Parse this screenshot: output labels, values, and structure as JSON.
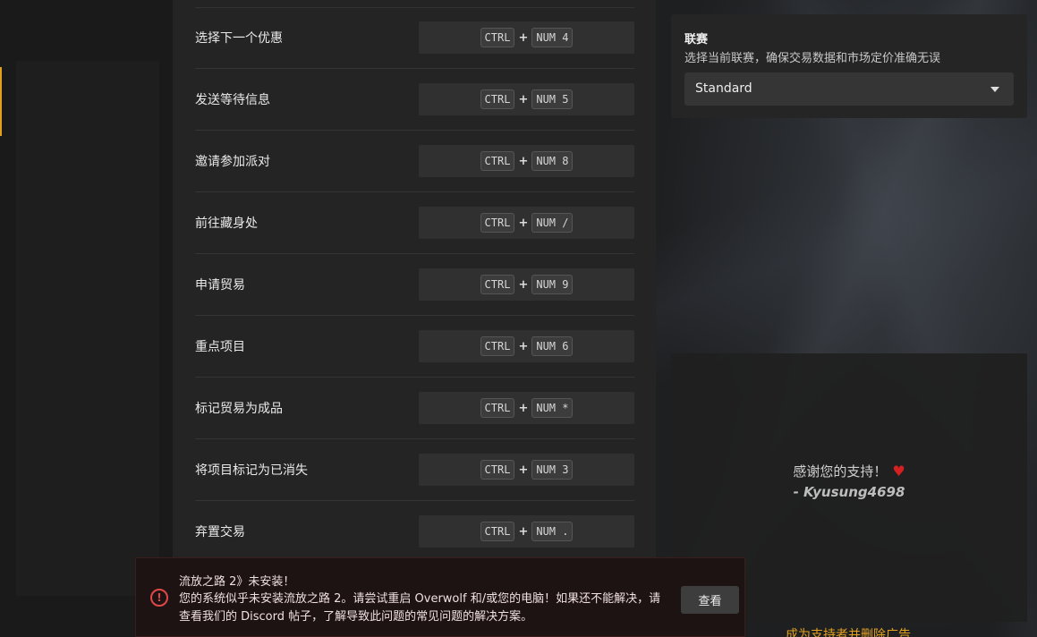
{
  "hotkeys": [
    {
      "label": "选择下一个优惠",
      "mod": "CTRL",
      "key": "NUM 4"
    },
    {
      "label": "发送等待信息",
      "mod": "CTRL",
      "key": "NUM 5"
    },
    {
      "label": "邀请参加派对",
      "mod": "CTRL",
      "key": "NUM 8"
    },
    {
      "label": "前往藏身处",
      "mod": "CTRL",
      "key": "NUM /"
    },
    {
      "label": "申请贸易",
      "mod": "CTRL",
      "key": "NUM 9"
    },
    {
      "label": "重点项目",
      "mod": "CTRL",
      "key": "NUM 6"
    },
    {
      "label": "标记贸易为成品",
      "mod": "CTRL",
      "key": "NUM *"
    },
    {
      "label": "将项目标记为已消失",
      "mod": "CTRL",
      "key": "NUM 3"
    },
    {
      "label": "弃置交易",
      "mod": "CTRL",
      "key": "NUM ."
    }
  ],
  "plus_sign": "+",
  "league": {
    "title": "联赛",
    "description": "选择当前联赛，确保交易数据和市场定价准确无误",
    "selected": "Standard"
  },
  "support": {
    "thanks": "感谢您的支持！",
    "author": "- Kyusung4698",
    "remove_ads": "成为支持者并删除广告"
  },
  "toast": {
    "icon": "!",
    "title": "流放之路 2》未安装！",
    "message": "您的系统似乎未安装流放之路 2。请尝试重启 Overwolf 和/或您的电脑！如果还不能解决，请查看我们的 Discord 帖子，了解导致此问题的常见问题的解决方案。",
    "button": "查看"
  },
  "colors": {
    "accent": "#e0a020",
    "error": "#e04848",
    "heart": "#d42020"
  }
}
